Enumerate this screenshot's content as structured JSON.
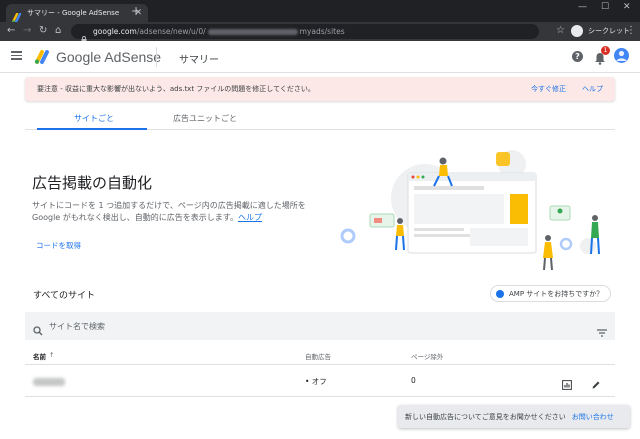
{
  "browser": {
    "tab_title": "サマリー - Google AdSense",
    "tab_close": "✕",
    "new_tab": "+",
    "url_domain": "google.com",
    "url_path_start": "/adsense/new/u/0/",
    "url_path_end": "myads/sites",
    "incognito_label": "シークレット",
    "window_controls": [
      "—",
      "☐",
      "✕"
    ]
  },
  "header": {
    "brand": "Google AdSense",
    "page_title": "サマリー",
    "notification_count": "1",
    "help_glyph": "?"
  },
  "alert": {
    "text": "要注意 - 収益に重大な影響が出ないよう、ads.txt ファイルの問題を修正してください。",
    "fix_link": "今すぐ修正",
    "help_link": "ヘルプ"
  },
  "tabs": {
    "by_site": "サイトごと",
    "by_ad_unit": "広告ユニットごと"
  },
  "hero": {
    "title": "広告掲載の自動化",
    "description_line1": "サイトにコードを 1 つ追加するだけで、ページ内の広告掲載に適した場所を",
    "description_line2": "Google がもれなく検出し、自動的に広告を表示します。",
    "help_link": "ヘルプ",
    "get_code": "コードを取得"
  },
  "sites": {
    "title": "すべてのサイト",
    "amp_chip": "AMP サイトをお持ちですか？",
    "search_placeholder": "サイト名で検索",
    "columns": {
      "name": "名前",
      "sort_arrow": "↑",
      "auto_ads": "自動広告",
      "page_exclusions": "ページ除外"
    },
    "rows": [
      {
        "auto_ads": "• オフ",
        "page_exclusions": "0"
      }
    ]
  },
  "snackbar": {
    "text": "新しい自動広告についてご意見をお聞かせください",
    "link": "お問い合わせ"
  },
  "colors": {
    "accent": "#1a73e8",
    "alert_bg": "#fce8e6",
    "badge": "#d93025"
  }
}
